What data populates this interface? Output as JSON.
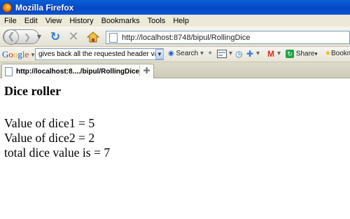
{
  "window": {
    "title": "Mozilla Firefox"
  },
  "menu": [
    "File",
    "Edit",
    "View",
    "History",
    "Bookmarks",
    "Tools",
    "Help"
  ],
  "navigation": {
    "url": "http://localhost:8748/bipul/RollingDice"
  },
  "google_toolbar": {
    "logo": "Google",
    "search_value": "gives back all the requested header values a",
    "search_label": "Search",
    "share_label": "Share",
    "bookmarks_label": "Bookm"
  },
  "tabs": [
    {
      "label": "http://localhost:8..../bipul/RollingDice"
    }
  ],
  "page": {
    "heading": "Dice roller",
    "lines": [
      "Value of dice1 = 5",
      "Value of dice2 = 2",
      "total dice value is = 7"
    ]
  },
  "colors": {
    "titlebar": "#0449c4",
    "chrome": "#ece9d8",
    "page_background": "#ffffff"
  }
}
